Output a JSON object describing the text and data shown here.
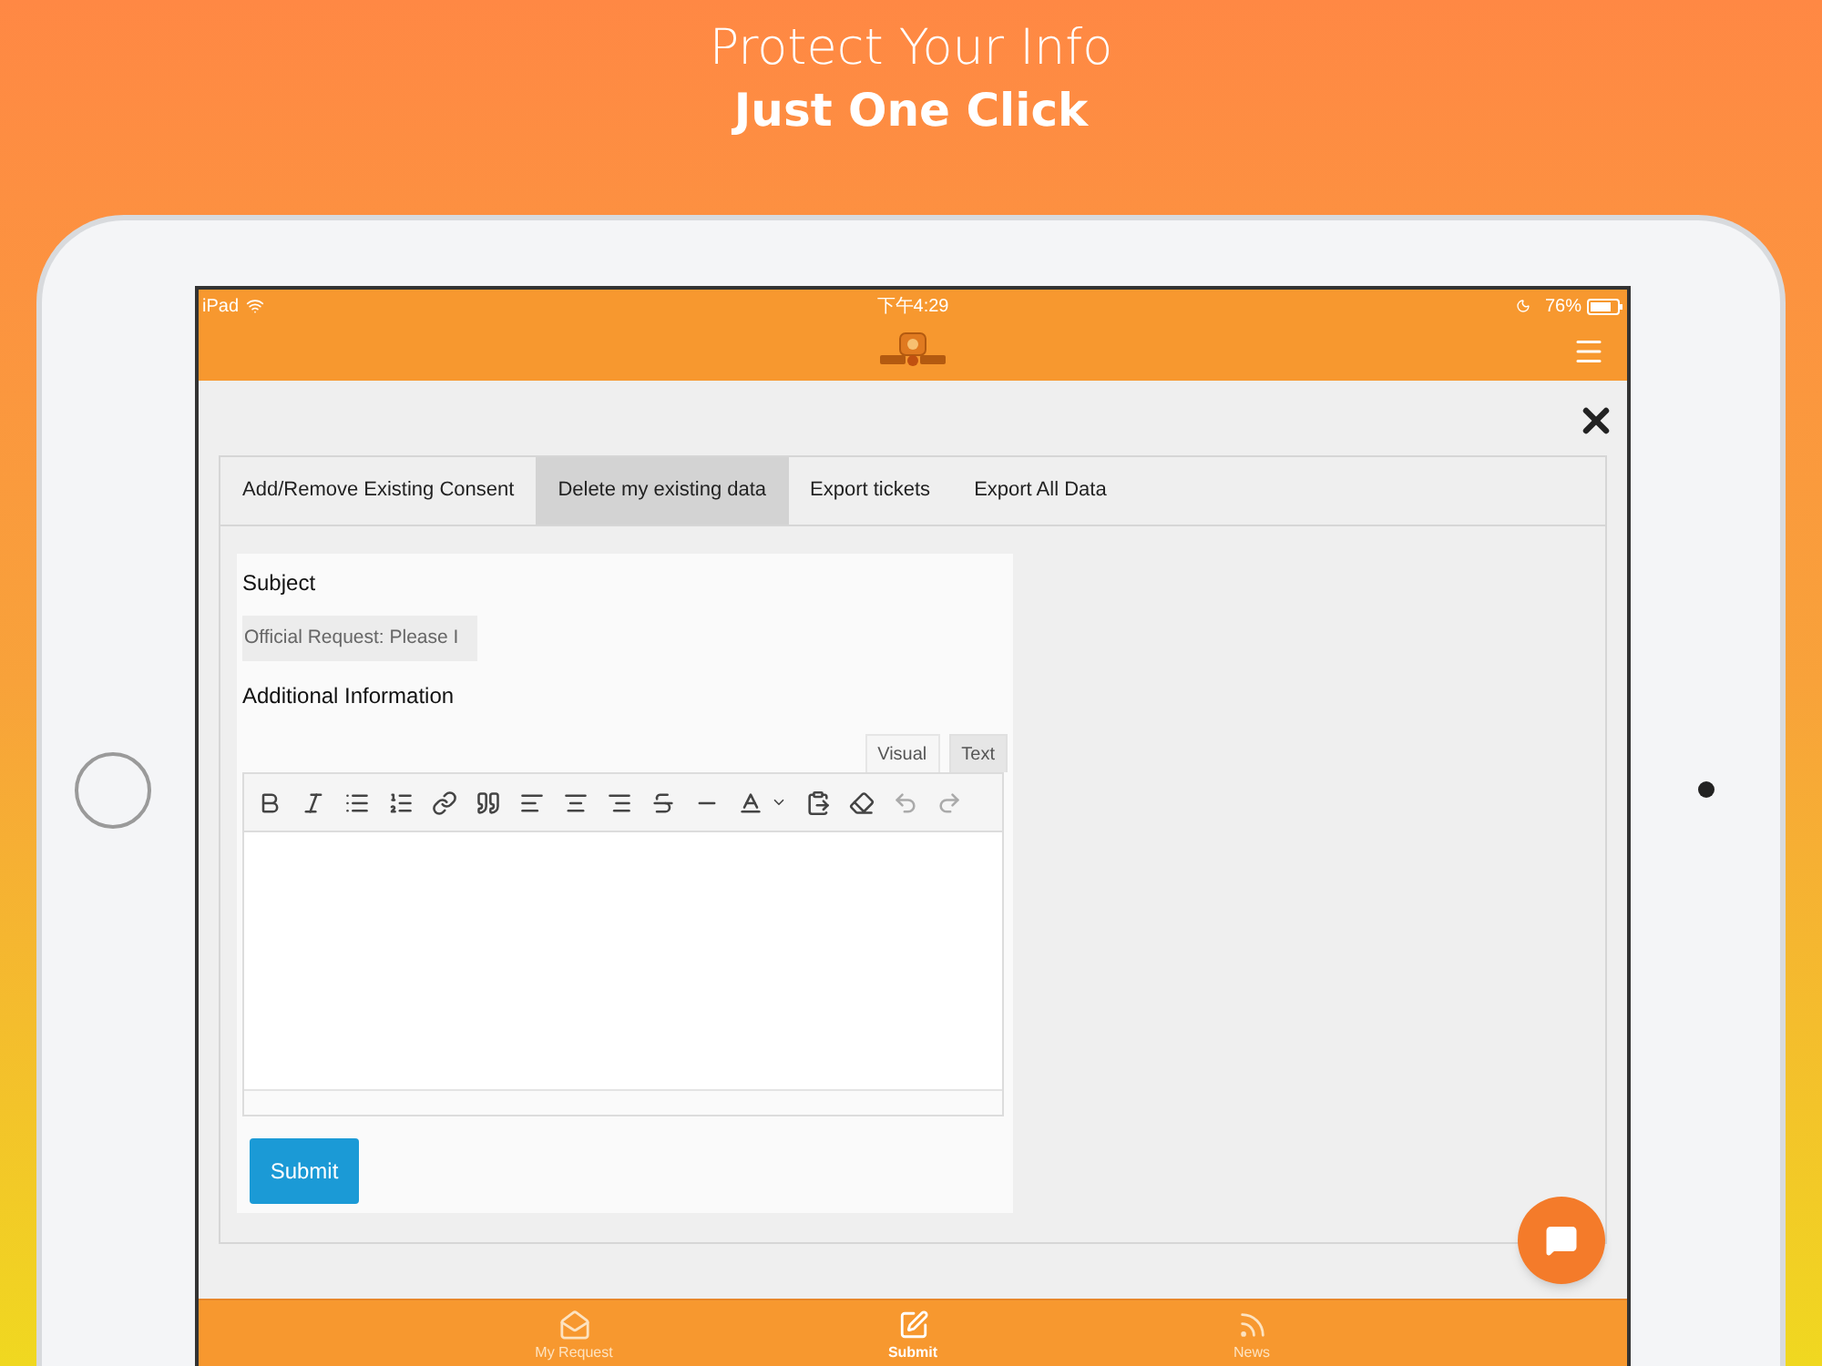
{
  "header": {
    "title": "Protect Your Info",
    "subtitle": "Just One Click"
  },
  "status_bar": {
    "carrier": "iPad",
    "time": "下午4:29",
    "battery": "76%"
  },
  "tabs": [
    {
      "label": "Add/Remove Existing Consent",
      "selected": false
    },
    {
      "label": "Delete my existing data",
      "selected": true
    },
    {
      "label": "Export tickets",
      "selected": false
    },
    {
      "label": "Export All Data",
      "selected": false
    }
  ],
  "form": {
    "subject_label": "Subject",
    "subject_value": "Official Request: Please I",
    "info_label": "Additional Information",
    "editor_tabs": [
      {
        "label": "Visual",
        "selected": true
      },
      {
        "label": "Text",
        "selected": false
      }
    ],
    "submit": "Submit"
  },
  "bottom_nav": [
    {
      "label": "My Request",
      "selected": false,
      "kind": "mail"
    },
    {
      "label": "Submit",
      "selected": true,
      "kind": "edit"
    },
    {
      "label": "News",
      "selected": false,
      "kind": "rss"
    }
  ]
}
